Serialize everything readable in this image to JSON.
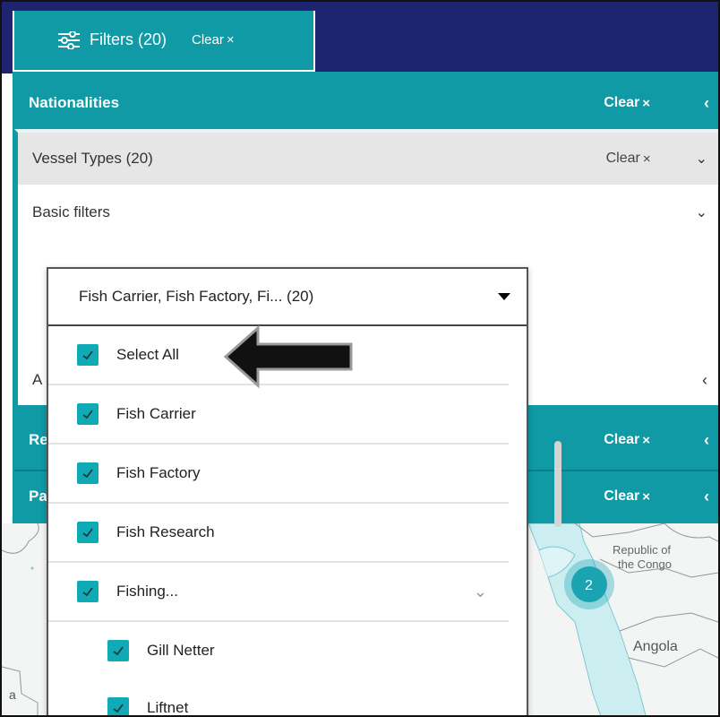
{
  "topbar": {
    "filters_label": "Filters (20)",
    "clear_label": "Clear",
    "clear_x": "×",
    "filters_icon": "sliders-icon"
  },
  "sections": {
    "nationalities": {
      "title": "Nationalities",
      "clear": "Clear",
      "x": "×",
      "chevron": "‹"
    },
    "re": {
      "title": "Re",
      "clear": "Clear",
      "x": "×",
      "chevron": "‹"
    },
    "pa": {
      "title": "Pa",
      "clear": "Clear",
      "x": "×",
      "chevron": "‹"
    }
  },
  "vessel_types": {
    "label": "Vessel Types (20)",
    "clear": "Clear",
    "x": "×",
    "chevron": "⌄"
  },
  "basic_filters": {
    "label": "Basic filters",
    "chevron": "⌄"
  },
  "a_row": {
    "label": "A",
    "chevron": "‹"
  },
  "dropdown": {
    "selected_value": "Fish Carrier, Fish Factory, Fi... (20)",
    "options": [
      {
        "label": "Select All",
        "checked": true
      },
      {
        "label": "Fish Carrier",
        "checked": true
      },
      {
        "label": "Fish Factory",
        "checked": true
      },
      {
        "label": "Fish Research",
        "checked": true
      },
      {
        "label": "Fishing...",
        "checked": true,
        "expandable": true,
        "chevron": "⌄"
      },
      {
        "label": "Gill Netter",
        "checked": true,
        "child": true
      },
      {
        "label": "Liftnet",
        "checked": true,
        "child": true
      }
    ]
  },
  "map": {
    "labels": {
      "republic_of_congo_1": "Republic of",
      "republic_of_congo_2": "the Congo",
      "angola": "Angola",
      "cluster_count": "2",
      "edge_a": "a"
    },
    "colors": {
      "water": "#ffffff",
      "land": "#f3f5f5",
      "highlight": "#cdeef1",
      "cluster": "#1aa4b1"
    }
  },
  "colors": {
    "teal": "#0f9aa6",
    "navy": "#1f2470",
    "checkbox": "#10aab7"
  }
}
